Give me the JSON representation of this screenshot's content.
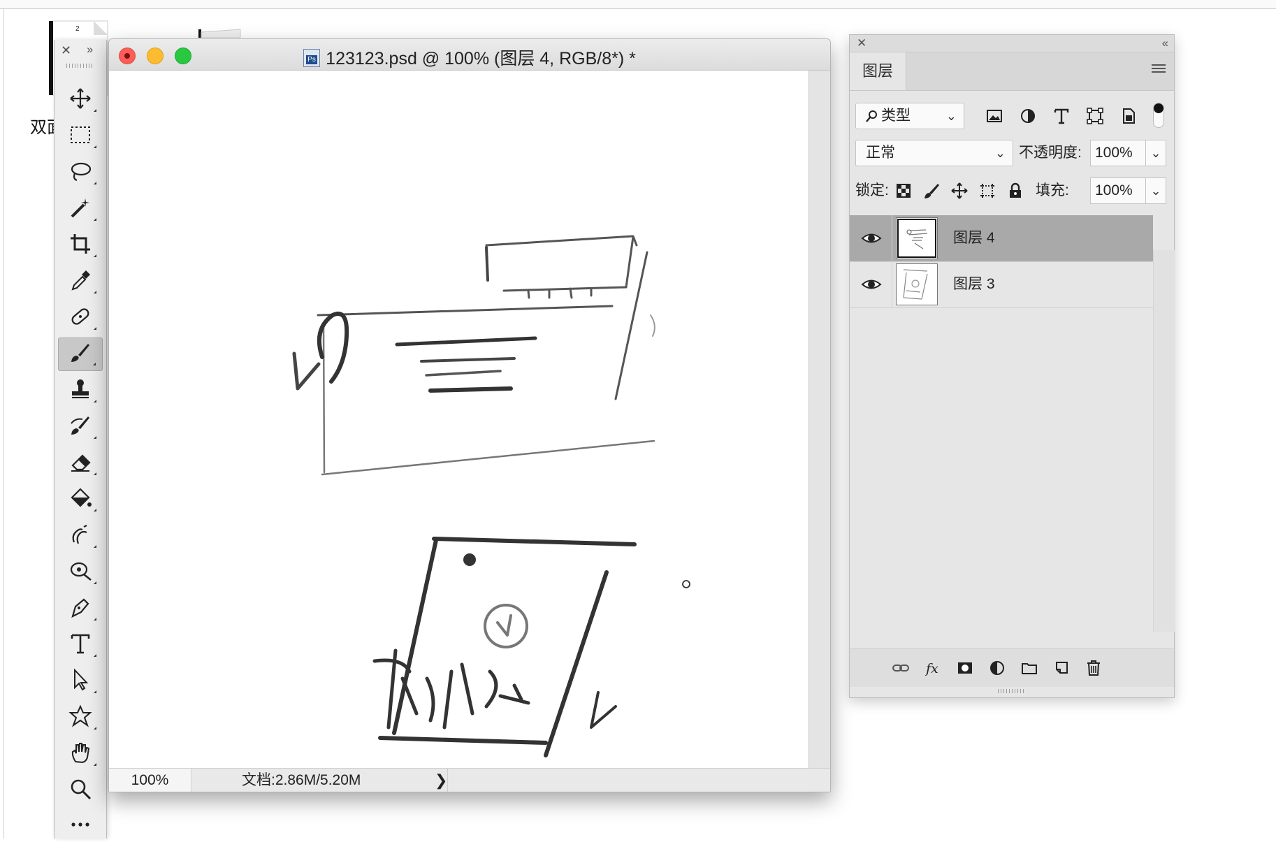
{
  "desktop": {
    "label": "双面",
    "icon1_text": "2"
  },
  "toolbar": {
    "close": "✕",
    "expand": "››",
    "tools": [
      {
        "name": "move-tool",
        "icon": "move-icon"
      },
      {
        "name": "marquee-tool",
        "icon": "rect-marquee-icon"
      },
      {
        "name": "lasso-tool",
        "icon": "lasso-icon"
      },
      {
        "name": "magic-wand-tool",
        "icon": "magic-wand-icon"
      },
      {
        "name": "crop-tool",
        "icon": "crop-icon"
      },
      {
        "name": "eyedropper-tool",
        "icon": "eyedropper-icon"
      },
      {
        "name": "healing-tool",
        "icon": "bandage-icon"
      },
      {
        "name": "brush-tool",
        "icon": "brush-icon",
        "active": true
      },
      {
        "name": "stamp-tool",
        "icon": "stamp-icon"
      },
      {
        "name": "history-brush-tool",
        "icon": "history-brush-icon"
      },
      {
        "name": "eraser-tool",
        "icon": "eraser-icon"
      },
      {
        "name": "paint-bucket-tool",
        "icon": "paint-bucket-icon"
      },
      {
        "name": "smudge-tool",
        "icon": "smudge-icon"
      },
      {
        "name": "dodge-tool",
        "icon": "dodge-icon"
      },
      {
        "name": "pen-tool",
        "icon": "pen-icon"
      },
      {
        "name": "type-tool",
        "icon": "type-icon"
      },
      {
        "name": "path-select-tool",
        "icon": "arrow-icon"
      },
      {
        "name": "shape-tool",
        "icon": "custom-shape-icon"
      },
      {
        "name": "hand-tool",
        "icon": "hand-icon"
      },
      {
        "name": "zoom-tool",
        "icon": "zoom-icon"
      },
      {
        "name": "more-tools",
        "icon": "ellipsis-icon"
      }
    ]
  },
  "document": {
    "title": "123123.psd @ 100% (图层 4, RGB/8*) *",
    "zoom": "100%",
    "doc_info": "文档:2.86M/5.20M",
    "arrow": "❯"
  },
  "layers_panel": {
    "close": "✕",
    "collapse": "‹‹",
    "tab": "图层",
    "filter_type": "类型",
    "blend_mode": "正常",
    "opacity_label": "不透明度:",
    "opacity_value": "100%",
    "lock_label": "锁定:",
    "fill_label": "填充:",
    "fill_value": "100%",
    "layers": [
      {
        "name": "图层 4",
        "selected": true,
        "visible": true
      },
      {
        "name": "图层 3",
        "selected": false,
        "visible": true
      }
    ]
  },
  "colors": {
    "accent_red": "#fc5d56",
    "accent_yellow": "#fdbb2f",
    "accent_green": "#29c840",
    "selected_layer": "#a9a9a9"
  }
}
